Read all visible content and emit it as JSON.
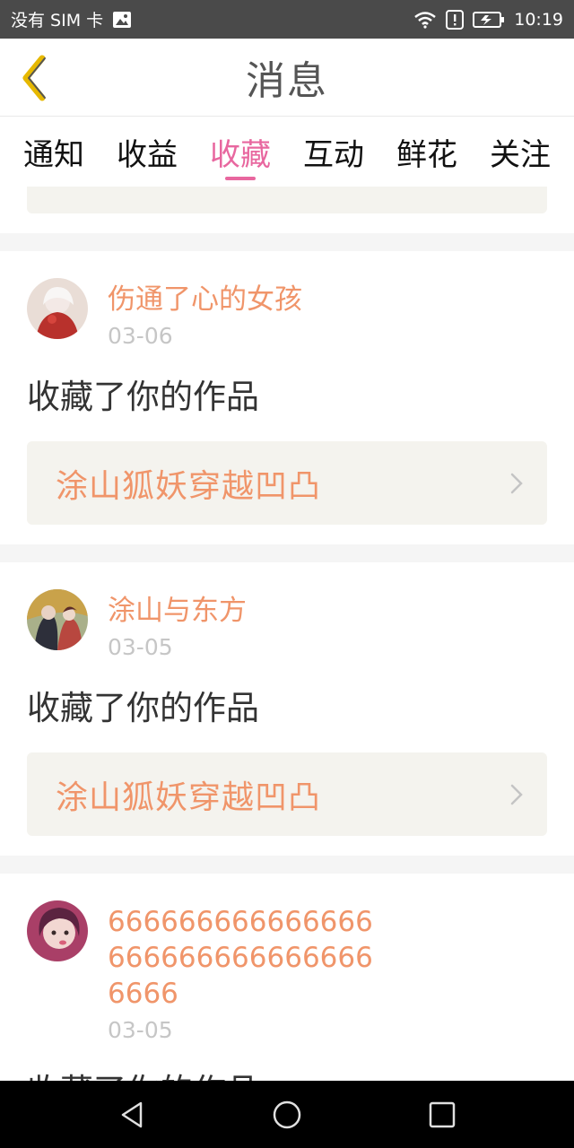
{
  "status_bar": {
    "carrier": "没有 SIM 卡",
    "time": "10:19"
  },
  "header": {
    "title": "消息"
  },
  "tabs": [
    {
      "label": "通知"
    },
    {
      "label": "收益"
    },
    {
      "label": "收藏",
      "active": true
    },
    {
      "label": "互动"
    },
    {
      "label": "鲜花"
    },
    {
      "label": "关注"
    }
  ],
  "messages": [
    {
      "username": "伤通了心的女孩",
      "date": "03-06",
      "action": "收藏了你的作品",
      "work_title": "涂山狐妖穿越凹凸"
    },
    {
      "username": "涂山与东方",
      "date": "03-05",
      "action": "收藏了你的作品",
      "work_title": "涂山狐妖穿越凹凸"
    },
    {
      "username": "6666666666666666666666666666666666",
      "date": "03-05",
      "action": "收藏了你的作品"
    }
  ],
  "colors": {
    "accent": "#e8679f",
    "username": "#f0956a",
    "work_bg": "#f4f3ee"
  }
}
